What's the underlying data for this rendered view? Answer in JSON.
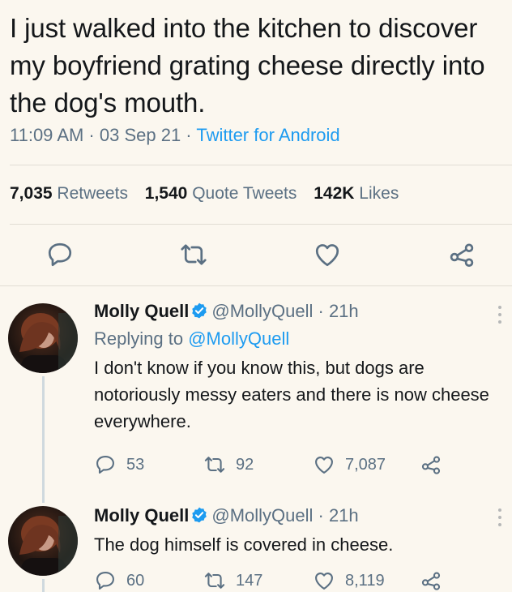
{
  "tweet": {
    "text": "I just walked into the kitchen to discover my boyfriend grating cheese directly into the dog's mouth.",
    "time": "11:09 AM · 03 Sep 21 · ",
    "source": "Twitter for Android",
    "retweets_count": "7,035",
    "retweets_label": "Retweets",
    "quotes_count": "1,540",
    "quotes_label": "Quote Tweets",
    "likes_count": "142K",
    "likes_label": "Likes"
  },
  "replies": [
    {
      "name": "Molly Quell",
      "handle": "@MollyQuell · 21h",
      "replying_prefix": "Replying to ",
      "replying_to": "@MollyQuell",
      "text": "I don't know if you know this, but dogs are notoriously messy eaters and there is now cheese everywhere.",
      "reply_count": "53",
      "retweet_count": "92",
      "like_count": "7,087"
    },
    {
      "name": "Molly Quell",
      "handle": "@MollyQuell · 21h",
      "text": "The dog himself is covered in cheese.",
      "reply_count": "60",
      "retweet_count": "147",
      "like_count": "8,119"
    }
  ],
  "colors": {
    "accent": "#1d9bf0",
    "muted": "#5b7083",
    "background": "#fbf7ef"
  }
}
